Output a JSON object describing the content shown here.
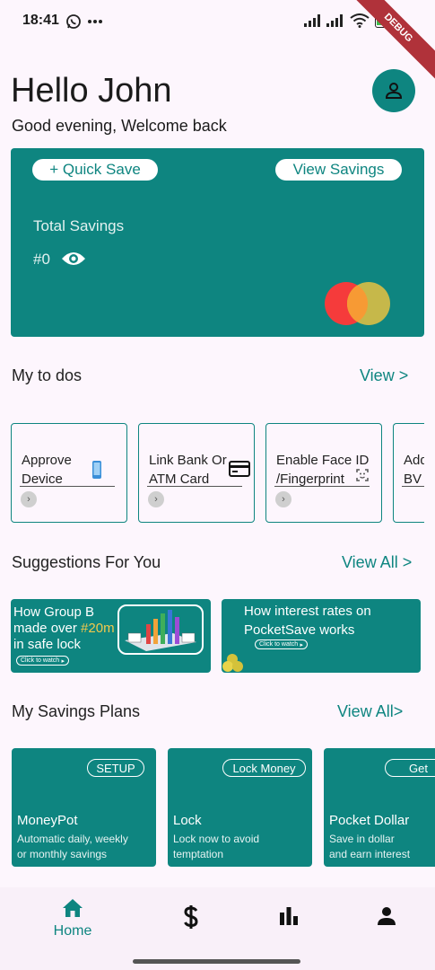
{
  "status": {
    "time": "18:41",
    "battery": "50",
    "debug_label": "DEBUG"
  },
  "header": {
    "greeting": "Hello John",
    "subtitle": "Good evening, Welcome back"
  },
  "savings_card": {
    "quick_save_label": "+ Quick Save",
    "view_savings_label": "View Savings",
    "total_label": "Total Savings",
    "total_value": "#0"
  },
  "todos": {
    "title": "My to dos",
    "link": "View >",
    "items": [
      {
        "line1": "Approve",
        "line2": "Device",
        "icon": "phone-icon"
      },
      {
        "line1": "Link Bank Or",
        "line2": "ATM Card",
        "icon": "card-icon"
      },
      {
        "line1": "Enable Face ID",
        "line2": "/Fingerprint",
        "icon": "face-scan-icon"
      },
      {
        "line1": "Add",
        "line2": "BV",
        "icon": ""
      }
    ]
  },
  "suggestions": {
    "title": "Suggestions For You",
    "link": "View All >",
    "items": [
      {
        "line1": "How Group B",
        "line2a": "made over ",
        "highlight": "#20m",
        "line3": "in safe lock",
        "watch": "Click to watch"
      },
      {
        "line1": "How interest rates on",
        "line2": "PocketSave works",
        "watch": "Click to watch"
      }
    ]
  },
  "plans": {
    "title": "My Savings Plans",
    "link": "View All>",
    "items": [
      {
        "badge": "SETUP",
        "name": "MoneyPot",
        "desc1": "Automatic daily, weekly",
        "desc2": "or monthly savings"
      },
      {
        "badge": "Lock Money",
        "name": "Lock",
        "desc1": "Lock now to avoid",
        "desc2": "temptation"
      },
      {
        "badge": "Get",
        "name": "Pocket Dollar",
        "desc1": "Save in dollar",
        "desc2": "and earn interest"
      }
    ]
  },
  "nav": {
    "home_label": "Home"
  },
  "colors": {
    "accent": "#0e8580",
    "highlight": "#f2c94c",
    "background": "#fdf6fd"
  }
}
